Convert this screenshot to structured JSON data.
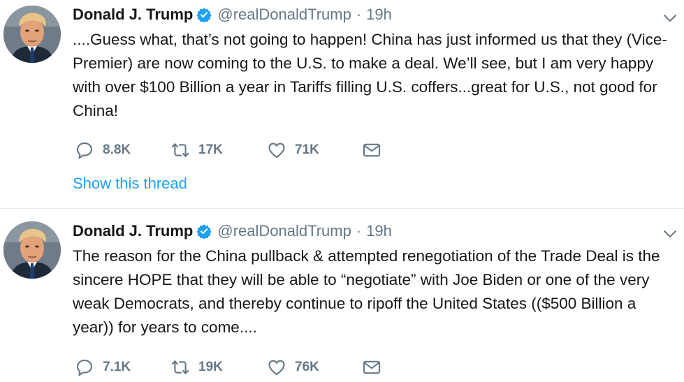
{
  "colors": {
    "verified": "#1da1f2",
    "link": "#1da1f2",
    "secondary_text": "#657786",
    "divider": "#e6ecf0"
  },
  "tweets": [
    {
      "author": {
        "name": "Donald J. Trump",
        "handle": "@realDonaldTrump",
        "verified_icon": "verified-badge-icon"
      },
      "separator": "·",
      "time": "19h",
      "text": "....Guess what, that’s not going to happen! China has just informed us that they (Vice-Premier) are now coming to the U.S. to make a deal. We’ll see, but I am very happy with over $100 Billion a year in Tariffs filling U.S. coffers...great for U.S., not good for China!",
      "stats": {
        "replies": "8.8K",
        "retweets": "17K",
        "likes": "71K"
      },
      "thread_link": "Show this thread"
    },
    {
      "author": {
        "name": "Donald J. Trump",
        "handle": "@realDonaldTrump",
        "verified_icon": "verified-badge-icon"
      },
      "separator": "·",
      "time": "19h",
      "text": "The reason for the China pullback & attempted renegotiation of the Trade Deal is the sincere HOPE that they will be able to “negotiate” with Joe Biden or one of the very weak Democrats, and thereby continue to ripoff the United States (($500 Billion a year)) for years to come....",
      "stats": {
        "replies": "7.1K",
        "retweets": "19K",
        "likes": "76K"
      }
    }
  ]
}
